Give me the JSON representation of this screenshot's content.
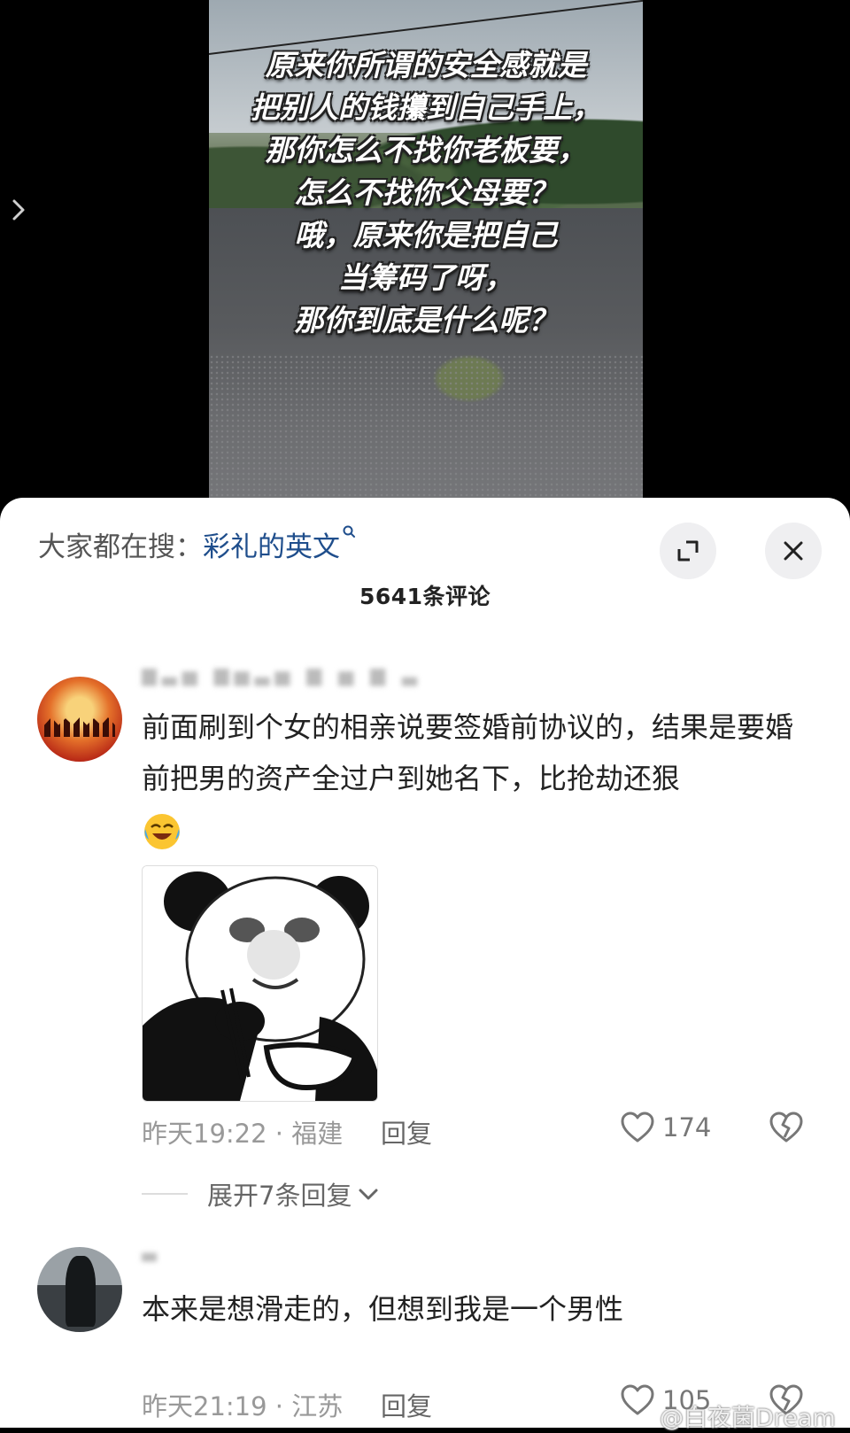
{
  "video": {
    "overlay_lines": [
      "原来你所谓的安全感就是",
      "把别人的钱攥到自己手上，",
      "那你怎么不找你老板要，",
      "怎么不找你父母要？",
      "哦，原来你是把自己",
      "当筹码了呀，",
      "那你到底是什么呢？"
    ]
  },
  "search": {
    "prefix": "大家都在搜：",
    "term": "彩礼的英文"
  },
  "comments_header": {
    "count_label": "5641条评论"
  },
  "comments": [
    {
      "username": "▆▃▅ ▆▅▃▅ ▆ ▅ ▆ ▃",
      "text": "前面刷到个女的相亲说要签婚前协议的，结果是要婚前把男的资产全过户到她名下，比抢劫还狠",
      "time_location": "昨天19:22 · 福建",
      "reply_label": "回复",
      "like_count": "174",
      "expand_label": "展开7条回复"
    },
    {
      "username": "▃",
      "text": "本来是想滑走的，但想到我是一个男性",
      "time_location": "昨天21:19 · 江苏",
      "reply_label": "回复",
      "like_count": "105"
    }
  ],
  "watermark": "@白夜菌Dream",
  "colors": {
    "search_term": "#1f4e8c",
    "sheet_bg": "#ffffff",
    "meta_gray": "#999999"
  }
}
